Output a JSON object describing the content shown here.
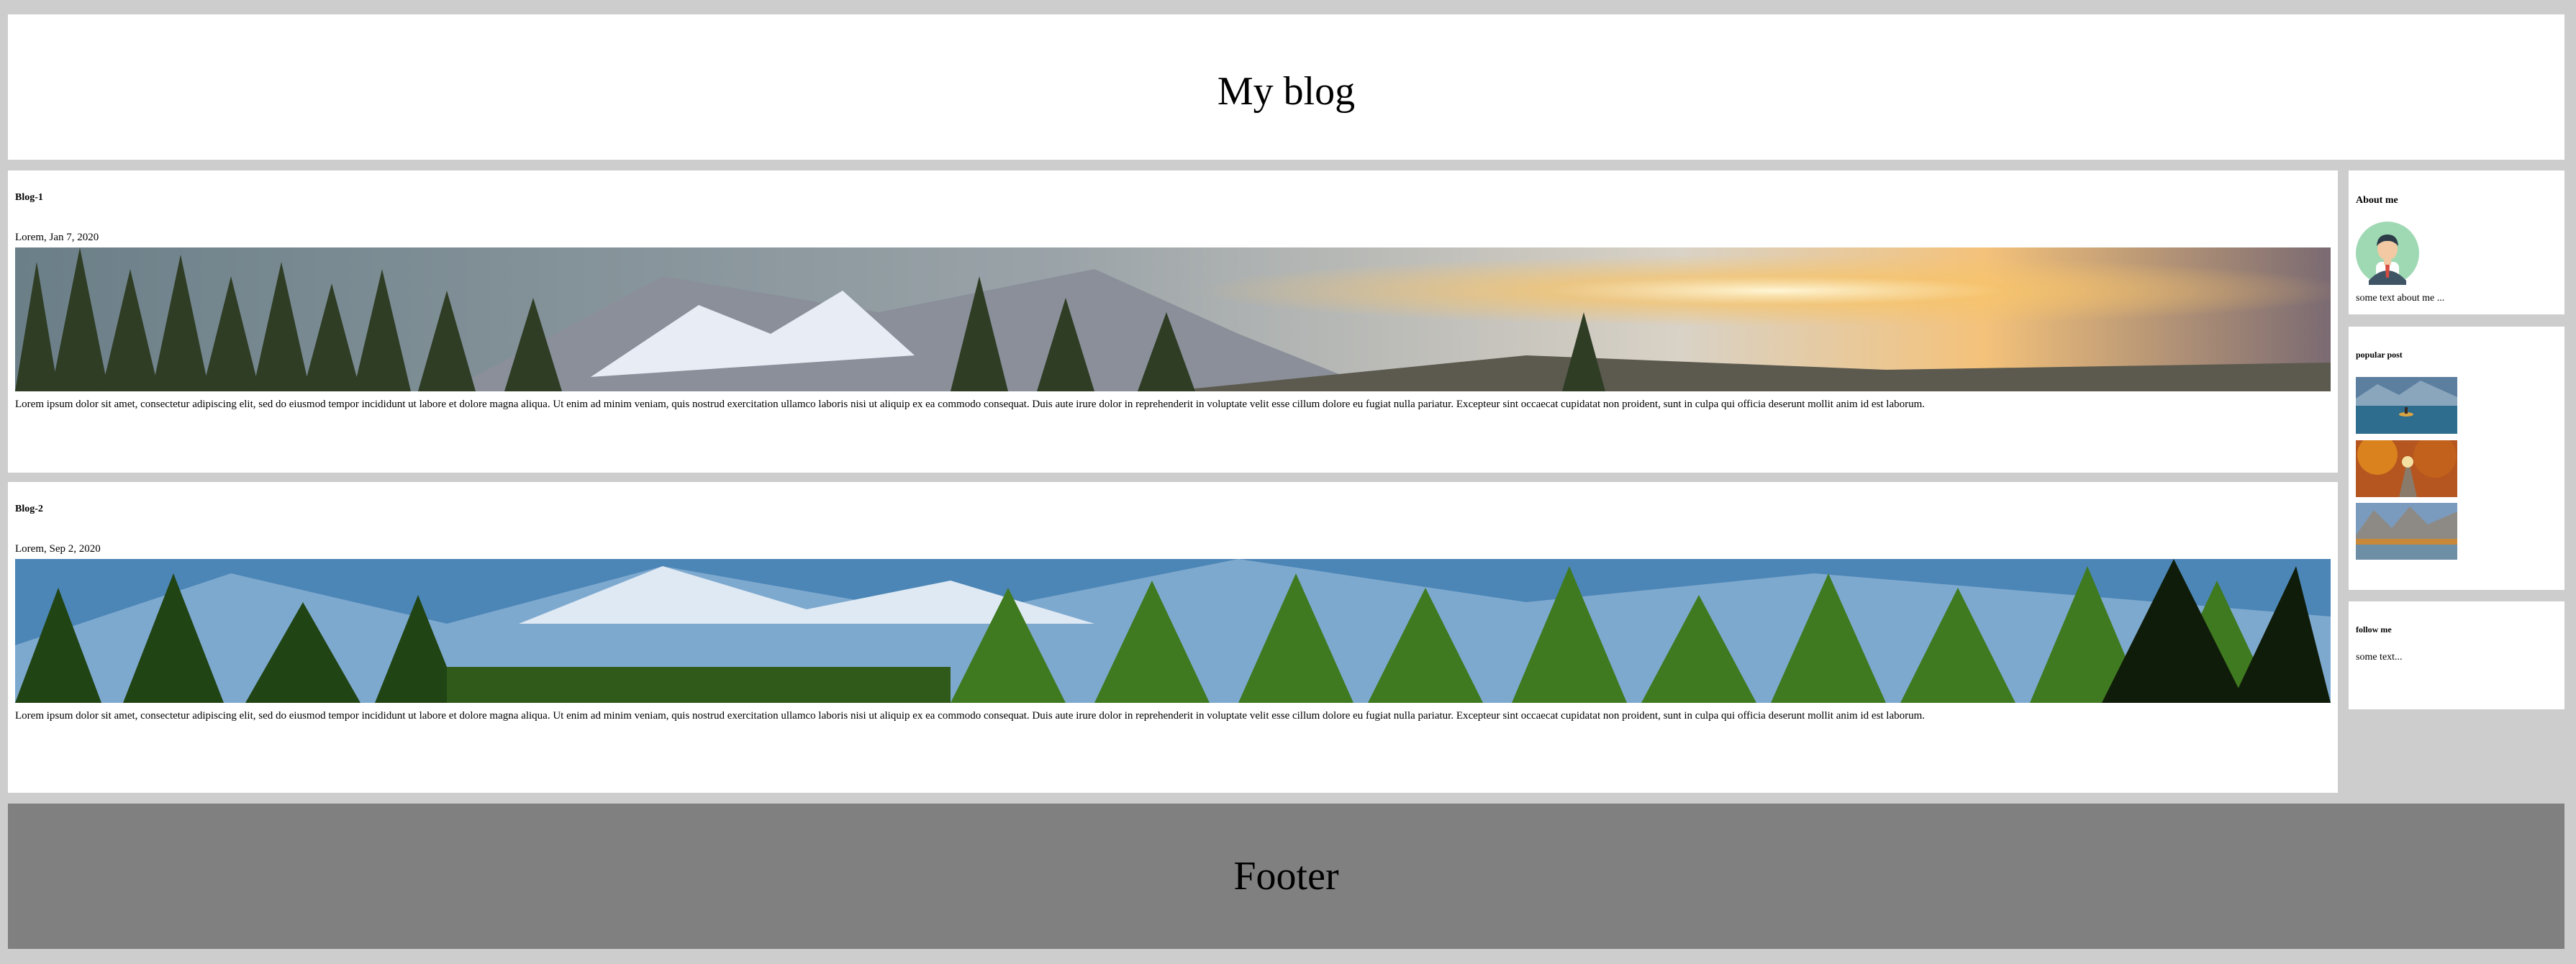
{
  "header": {
    "title": "My blog"
  },
  "posts": [
    {
      "title": "Blog-1",
      "date": "Lorem, Jan 7, 2020",
      "image": "mountain-sunrise-forest-banner",
      "body": "Lorem ipsum dolor sit amet, consectetur adipiscing elit, sed do eiusmod tempor incididunt ut labore et dolore magna aliqua. Ut enim ad minim veniam, quis nostrud exercitation ullamco laboris nisi ut aliquip ex ea commodo consequat. Duis aute irure dolor in reprehenderit in voluptate velit esse cillum dolore eu fugiat nulla pariatur. Excepteur sint occaecat cupidatat non proident, sunt in culpa qui officia deserunt mollit anim id est laborum."
    },
    {
      "title": "Blog-2",
      "date": "Lorem, Sep 2, 2020",
      "image": "pine-forest-mountains-banner",
      "body": "Lorem ipsum dolor sit amet, consectetur adipiscing elit, sed do eiusmod tempor incididunt ut labore et dolore magna aliqua. Ut enim ad minim veniam, quis nostrud exercitation ullamco laboris nisi ut aliquip ex ea commodo consequat. Duis aute irure dolor in reprehenderit in voluptate velit esse cillum dolore eu fugiat nulla pariatur. Excepteur sint occaecat cupidatat non proident, sunt in culpa qui officia deserunt mollit anim id est laborum."
    }
  ],
  "sidebar": {
    "about": {
      "heading": "About me",
      "avatar": "avatar-icon",
      "text": "some text about me ..."
    },
    "popular": {
      "heading": "popular post",
      "thumbs": [
        "lake-kayak-thumbnail",
        "autumn-road-thumbnail",
        "mountain-lake-thumbnail"
      ]
    },
    "follow": {
      "heading": "follow me",
      "text": "some text..."
    }
  },
  "footer": {
    "title": "Footer"
  },
  "colors": {
    "page_bg": "#cdcdcd",
    "card_bg": "#ffffff",
    "footer_bg": "#808080",
    "avatar_bg": "#9fd9b3"
  }
}
